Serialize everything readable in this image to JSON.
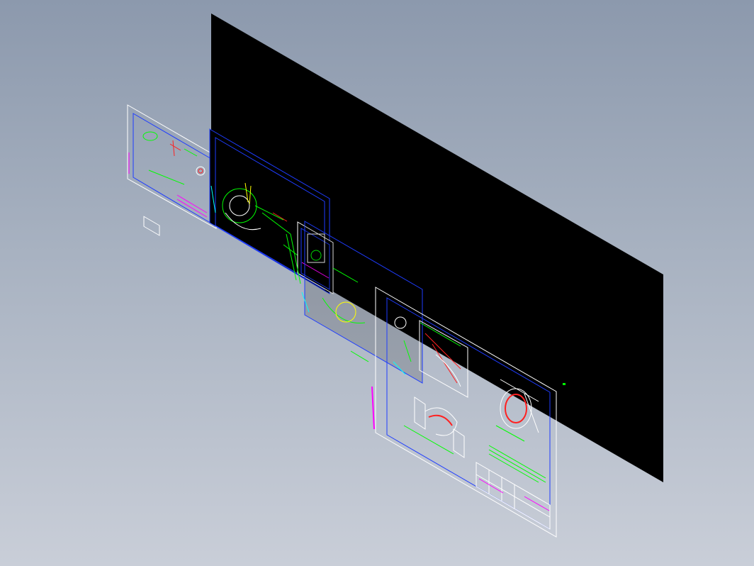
{
  "viewport": {
    "background_top": "#8c99ad",
    "background_bottom": "#c9ced8",
    "projection": "isometric"
  },
  "sheets": [
    {
      "id": "black-backdrop-sheet",
      "fill": "#000000",
      "border": "#000000"
    },
    {
      "id": "drawing-sheet-1",
      "fill": "none",
      "border": "#ffffff",
      "frame": "#1e3cff"
    },
    {
      "id": "drawing-sheet-2",
      "fill": "#000000",
      "border": "#1e3cff"
    },
    {
      "id": "drawing-sheet-3",
      "fill": "#000000",
      "border": "#ffffff",
      "frame": "#1e3cff"
    },
    {
      "id": "drawing-sheet-4",
      "fill": "#000000",
      "border": "#1e3cff"
    },
    {
      "id": "drawing-sheet-5",
      "fill": "none",
      "border": "#ffffff",
      "frame": "#1e3cff"
    }
  ],
  "line_colors": {
    "geometry": "#ffffff",
    "dimension": "#00ff00",
    "section": "#ff2020",
    "annotation": "#ff00ff",
    "center": "#ffff00",
    "frame": "#1e3cff",
    "hidden": "#00ffff"
  }
}
